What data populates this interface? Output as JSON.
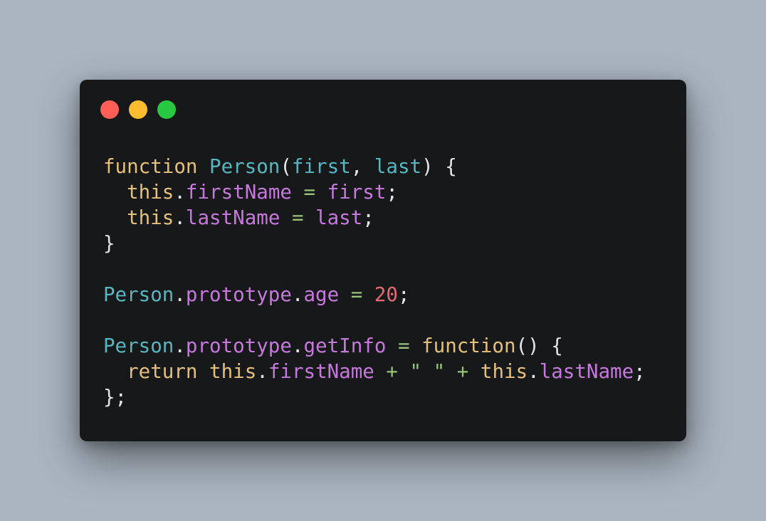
{
  "window": {
    "controls": [
      {
        "name": "close",
        "color": "#ff5f57"
      },
      {
        "name": "minimize",
        "color": "#febc2e"
      },
      {
        "name": "maximize",
        "color": "#28c840"
      }
    ]
  },
  "theme": {
    "keyword": "#e5c07b",
    "type": "#56b6c2",
    "property": "#c678dd",
    "operator": "#98c379",
    "number": "#e06c75",
    "punct": "#e6e6e6"
  },
  "code": {
    "lines": [
      [
        {
          "t": "function",
          "c": "keyword"
        },
        {
          "t": " ",
          "c": "punct"
        },
        {
          "t": "Person",
          "c": "type"
        },
        {
          "t": "(",
          "c": "punct"
        },
        {
          "t": "first",
          "c": "type"
        },
        {
          "t": ", ",
          "c": "punct"
        },
        {
          "t": "last",
          "c": "type"
        },
        {
          "t": ") {",
          "c": "punct"
        }
      ],
      [
        {
          "t": "  ",
          "c": "punct"
        },
        {
          "t": "this",
          "c": "keyword"
        },
        {
          "t": ".",
          "c": "punct"
        },
        {
          "t": "firstName",
          "c": "property"
        },
        {
          "t": " ",
          "c": "punct"
        },
        {
          "t": "=",
          "c": "operator"
        },
        {
          "t": " ",
          "c": "punct"
        },
        {
          "t": "first",
          "c": "property"
        },
        {
          "t": ";",
          "c": "punct"
        }
      ],
      [
        {
          "t": "  ",
          "c": "punct"
        },
        {
          "t": "this",
          "c": "keyword"
        },
        {
          "t": ".",
          "c": "punct"
        },
        {
          "t": "lastName",
          "c": "property"
        },
        {
          "t": " ",
          "c": "punct"
        },
        {
          "t": "=",
          "c": "operator"
        },
        {
          "t": " ",
          "c": "punct"
        },
        {
          "t": "last",
          "c": "property"
        },
        {
          "t": ";",
          "c": "punct"
        }
      ],
      [
        {
          "t": "}",
          "c": "punct"
        }
      ],
      [],
      [
        {
          "t": "Person",
          "c": "type"
        },
        {
          "t": ".",
          "c": "punct"
        },
        {
          "t": "prototype",
          "c": "property"
        },
        {
          "t": ".",
          "c": "punct"
        },
        {
          "t": "age",
          "c": "property"
        },
        {
          "t": " ",
          "c": "punct"
        },
        {
          "t": "=",
          "c": "operator"
        },
        {
          "t": " ",
          "c": "punct"
        },
        {
          "t": "20",
          "c": "number"
        },
        {
          "t": ";",
          "c": "punct"
        }
      ],
      [],
      [
        {
          "t": "Person",
          "c": "type"
        },
        {
          "t": ".",
          "c": "punct"
        },
        {
          "t": "prototype",
          "c": "property"
        },
        {
          "t": ".",
          "c": "punct"
        },
        {
          "t": "getInfo",
          "c": "property"
        },
        {
          "t": " ",
          "c": "punct"
        },
        {
          "t": "=",
          "c": "operator"
        },
        {
          "t": " ",
          "c": "punct"
        },
        {
          "t": "function",
          "c": "keyword"
        },
        {
          "t": "() {",
          "c": "punct"
        }
      ],
      [
        {
          "t": "  ",
          "c": "punct"
        },
        {
          "t": "return",
          "c": "keyword"
        },
        {
          "t": " ",
          "c": "punct"
        },
        {
          "t": "this",
          "c": "keyword"
        },
        {
          "t": ".",
          "c": "punct"
        },
        {
          "t": "firstName",
          "c": "property"
        },
        {
          "t": " ",
          "c": "punct"
        },
        {
          "t": "+",
          "c": "operator"
        },
        {
          "t": " ",
          "c": "punct"
        },
        {
          "t": "\" \"",
          "c": "operator"
        },
        {
          "t": " ",
          "c": "punct"
        },
        {
          "t": "+",
          "c": "operator"
        },
        {
          "t": " ",
          "c": "punct"
        },
        {
          "t": "this",
          "c": "keyword"
        },
        {
          "t": ".",
          "c": "punct"
        },
        {
          "t": "lastName",
          "c": "property"
        },
        {
          "t": ";",
          "c": "punct"
        }
      ],
      [
        {
          "t": "};",
          "c": "punct"
        }
      ]
    ]
  }
}
